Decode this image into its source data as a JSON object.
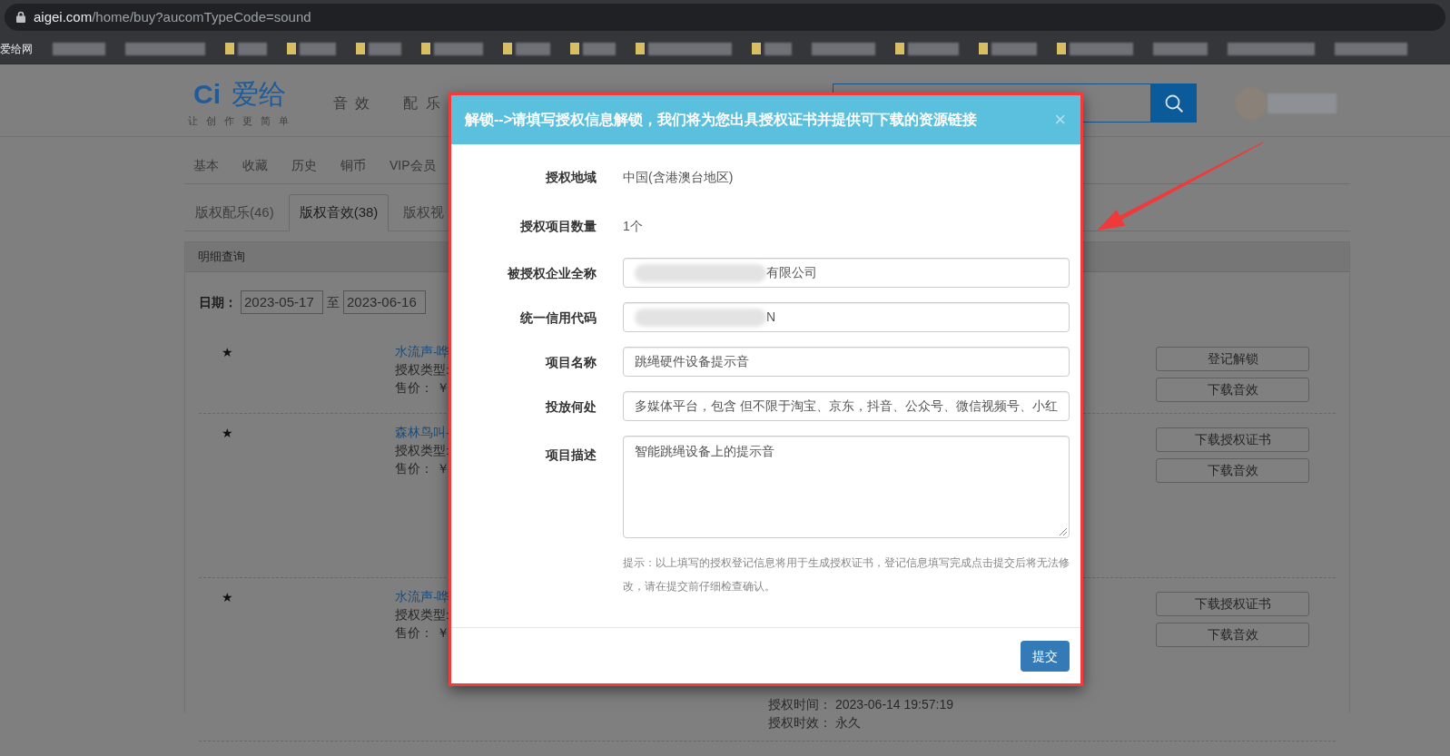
{
  "browser": {
    "url_host": "aigei.com",
    "url_path": "/home/buy?aucomTypeCode=sound",
    "bookmarks": [
      "爱给网"
    ]
  },
  "site_header": {
    "logo_mark": "Ci",
    "logo_name": "爱给",
    "tagline": "让 创 作 更 简 单",
    "nav": [
      "音 效",
      "配 乐"
    ]
  },
  "account_menu": [
    "基本",
    "收藏",
    "历史",
    "铜币",
    "VIP会员"
  ],
  "tabs": [
    {
      "label": "版权配乐(46)",
      "selected": false
    },
    {
      "label": "版权音效(38)",
      "selected": true
    },
    {
      "label": "版权视",
      "selected": false
    }
  ],
  "panel": {
    "title": "明细查询",
    "date_label": "日期：",
    "date_from": "2023-05-17",
    "date_to_word": "至",
    "date_to": "2023-06-16"
  },
  "records": [
    {
      "marker": "★",
      "title": "水流声-哗",
      "type_label": "授权类型:",
      "price_label": "售价： ￥",
      "actions": [
        "登记解锁",
        "下载音效"
      ]
    },
    {
      "marker": "★",
      "title": "森林鸟叫-",
      "type_label": "授权类型:",
      "price_label": "售价： ￥",
      "actions": [
        "下载授权证书",
        "下载音效"
      ]
    },
    {
      "marker": "★",
      "title": "水流声-哗",
      "type_label": "授权类型:",
      "price_label": "售价： ￥",
      "details": [
        {
          "label": "授权时间：",
          "value": "2023-06-14 19:57:19"
        },
        {
          "label": "授权时效：",
          "value": "永久"
        }
      ],
      "actions": [
        "下载授权证书",
        "下载音效"
      ]
    }
  ],
  "modal": {
    "title": "解锁-->请填写授权信息解锁，我们将为您出具授权证书并提供可下载的资源链接",
    "close": "×",
    "fields": [
      {
        "kind": "static",
        "label": "授权地域",
        "value": "中国(含港澳台地区)",
        "redacted": false
      },
      {
        "kind": "static",
        "label": "授权项目数量",
        "value": "1个",
        "redacted": false
      },
      {
        "kind": "input",
        "label": "被授权企业全称",
        "value": "有限公司",
        "redacted": true
      },
      {
        "kind": "input",
        "label": "统一信用代码",
        "value": "N",
        "redacted": true
      },
      {
        "kind": "input",
        "label": "项目名称",
        "value": "跳绳硬件设备提示音",
        "redacted": false
      },
      {
        "kind": "input",
        "label": "投放何处",
        "value": "多媒体平台，包含 但不限于淘宝、京东，抖音、公众号、微信视频号、小红",
        "redacted": false
      },
      {
        "kind": "textarea",
        "label": "项目描述",
        "value": "智能跳绳设备上的提示音",
        "redacted": false
      }
    ],
    "hint": "提示：以上填写的授权登记信息将用于生成授权证书，登记信息填写完成点击提交后将无法修改，请在提交前仔细检查确认。",
    "submit": "提交"
  }
}
